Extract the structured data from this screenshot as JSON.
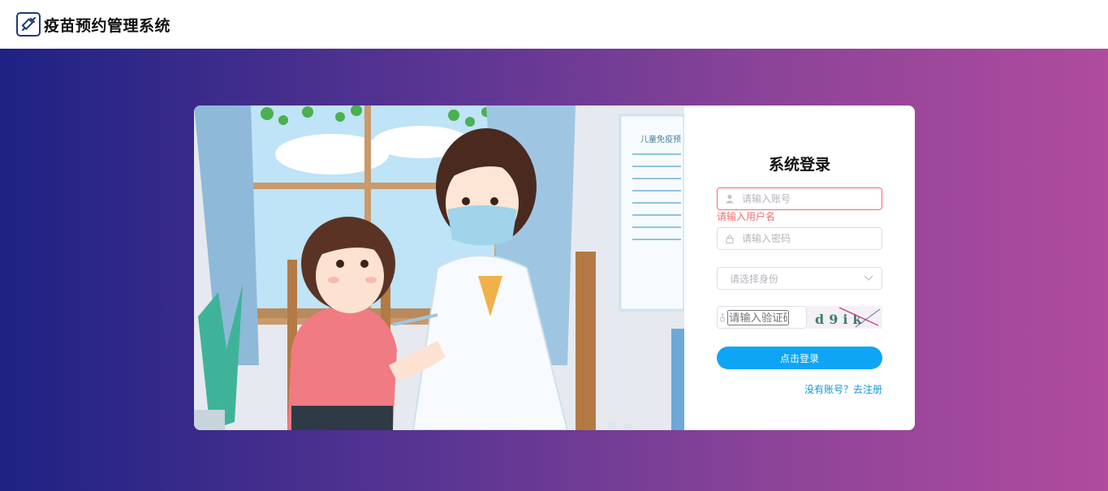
{
  "header": {
    "title": "疫苗预约管理系统"
  },
  "illustration": {
    "poster_text": "儿童免疫预"
  },
  "login": {
    "title": "系统登录",
    "username_placeholder": "请输入账号",
    "username_error": "请输入用户名",
    "password_placeholder": "请输入密码",
    "role_placeholder": "请选择身份",
    "captcha_placeholder": "请输入验证码",
    "captcha_text": "d9ik",
    "submit_label": "点击登录",
    "register_link": "没有账号？去注册"
  },
  "colors": {
    "primary": "#0ea5f5",
    "error": "#f56c6c",
    "link": "#1296db"
  }
}
